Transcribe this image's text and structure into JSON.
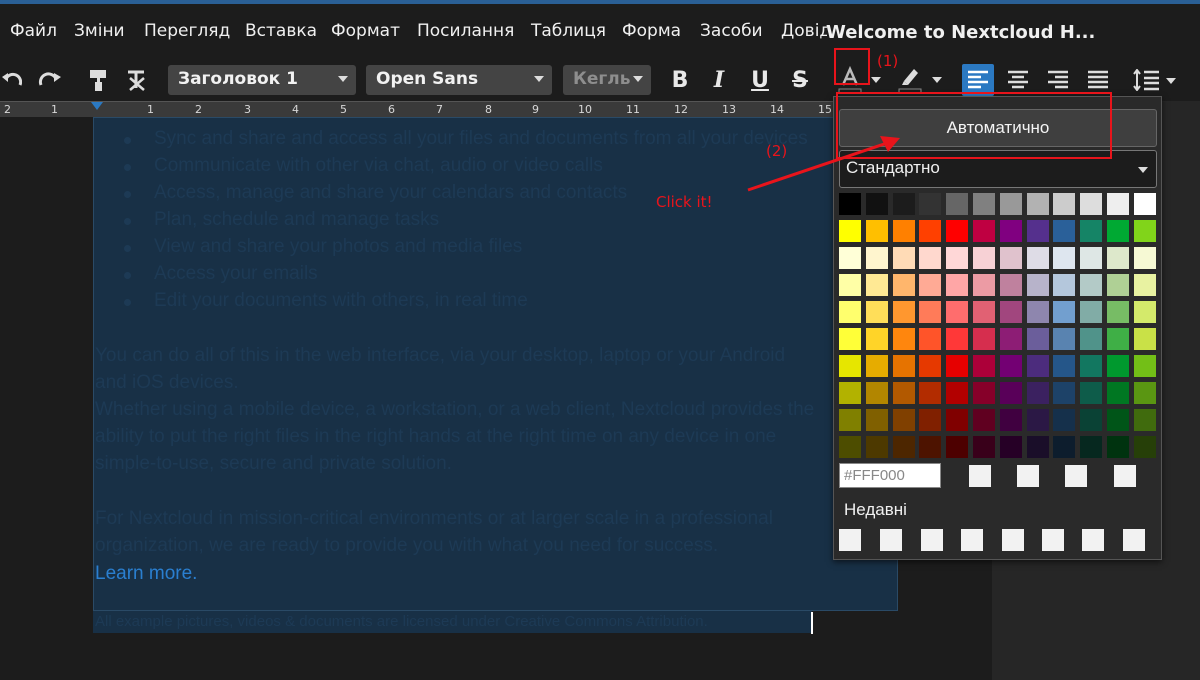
{
  "menubar": {
    "items": [
      "Файл",
      "Зміни",
      "Перегляд",
      "Вставка",
      "Формат",
      "Посилання",
      "Таблиця",
      "Форма",
      "Засоби",
      "Довідка"
    ],
    "doc_title": "Welcome to Nextcloud H..."
  },
  "toolbar": {
    "paragraph_style": "Заголовок 1",
    "font_name": "Open Sans",
    "font_size_placeholder": "Кегль",
    "icons": [
      "undo-icon",
      "redo-icon",
      "clone-formatting-icon",
      "clear-formatting-icon",
      "bold-icon",
      "italic-icon",
      "underline-icon",
      "strikethrough-icon",
      "font-color-icon",
      "highlight-icon",
      "align-left-icon",
      "align-center-icon",
      "align-right-icon",
      "justify-icon",
      "line-spacing-icon"
    ]
  },
  "ruler": {
    "ticks": [
      "2",
      "1",
      "1",
      "2",
      "3",
      "4",
      "5",
      "6",
      "7",
      "8",
      "9",
      "10",
      "11",
      "12",
      "13",
      "14",
      "15"
    ]
  },
  "document": {
    "bullets": [
      "Sync and share and access all your files and documents from all your devices",
      "Communicate with other via chat, audio or video calls",
      "Access, manage and share your calendars and contacts",
      "Plan, schedule and manage tasks",
      "View and share your photos and media files",
      "Access your emails",
      "Edit your documents with others, in real time"
    ],
    "para1_line1": "You can do all of this in the web interface, via your desktop, laptop or your Android",
    "para1_line2": "and iOS devices.",
    "para2_line1": "Whether using a mobile device, a workstation, or a web client, Nextcloud provides the",
    "para2_line2": "ability to put the right files in the right hands at the right time on any device in one",
    "para2_line3": "simple-to-use, secure and private solution.",
    "para3_line1": "For Nextcloud in mission-critical environments or at larger scale in a professional",
    "para3_line2": "organization, we are ready to provide you with what you need for success.",
    "learn_more": "Learn more.",
    "footnote": "All example pictures, videos & documents are licensed under Creative Commons Attribution."
  },
  "color_popup": {
    "auto_label": "Автоматично",
    "palette_name": "Стандартно",
    "hex_placeholder": "#FFF000",
    "recent_label": "Недавні",
    "swatches": [
      [
        "#000000",
        "#111111",
        "#1c1c1c",
        "#333333",
        "#666666",
        "#808080",
        "#999999",
        "#b2b2b2",
        "#cccccc",
        "#dddddd",
        "#eeeeee",
        "#ffffff"
      ],
      [
        "#ffff00",
        "#ffbf00",
        "#ff8000",
        "#ff4000",
        "#ff0000",
        "#bf0041",
        "#800080",
        "#55308d",
        "#2a6099",
        "#158466",
        "#00a933",
        "#81d41a"
      ],
      [
        "#ffffd7",
        "#fff5ce",
        "#ffdbb6",
        "#ffd8ce",
        "#ffd7d7",
        "#f7d1d5",
        "#e0c2cd",
        "#dedce6",
        "#dee6ef",
        "#dee7e5",
        "#dde8cb",
        "#f6f9d4"
      ],
      [
        "#ffffa6",
        "#ffe994",
        "#ffb66c",
        "#ffaa95",
        "#ffa6a6",
        "#ec9ba4",
        "#bf819e",
        "#b7b3ca",
        "#b4c7dc",
        "#b3cac7",
        "#afd095",
        "#e8f2a1"
      ],
      [
        "#ffff6d",
        "#ffde59",
        "#ff972f",
        "#ff7b59",
        "#ff6d6d",
        "#e16173",
        "#a1467e",
        "#8e86ae",
        "#729fcf",
        "#81aca6",
        "#77bc65",
        "#d4ea6b"
      ],
      [
        "#ffff38",
        "#ffd428",
        "#ff860d",
        "#ff5429",
        "#ff3838",
        "#d62e4e",
        "#8d1d75",
        "#6b5e9b",
        "#5983b0",
        "#50938a",
        "#3faf46",
        "#c9e147"
      ],
      [
        "#e6e600",
        "#e6ac00",
        "#e67300",
        "#e63900",
        "#e60000",
        "#ac0039",
        "#730073",
        "#4c2c7d",
        "#255689",
        "#127760",
        "#00992e",
        "#73bf17"
      ],
      [
        "#b2b200",
        "#b28600",
        "#b25900",
        "#b22c00",
        "#b20000",
        "#860029",
        "#590059",
        "#3b2160",
        "#1d4268",
        "#0e5c4a",
        "#007722",
        "#5a9612"
      ],
      [
        "#808000",
        "#806000",
        "#804000",
        "#802000",
        "#800000",
        "#600020",
        "#400040",
        "#2b1845",
        "#15304b",
        "#0a4235",
        "#005518",
        "#406b0d"
      ],
      [
        "#4d4d00",
        "#4d3900",
        "#4d2600",
        "#4d1300",
        "#4d0000",
        "#39001a",
        "#260026",
        "#1a0e29",
        "#0d1d2d",
        "#06281f",
        "#00330f",
        "#263f08"
      ]
    ]
  },
  "annotations": {
    "step1": "(1)",
    "step2": "(2)",
    "click": "Click it!",
    "color": "#e8141b"
  }
}
